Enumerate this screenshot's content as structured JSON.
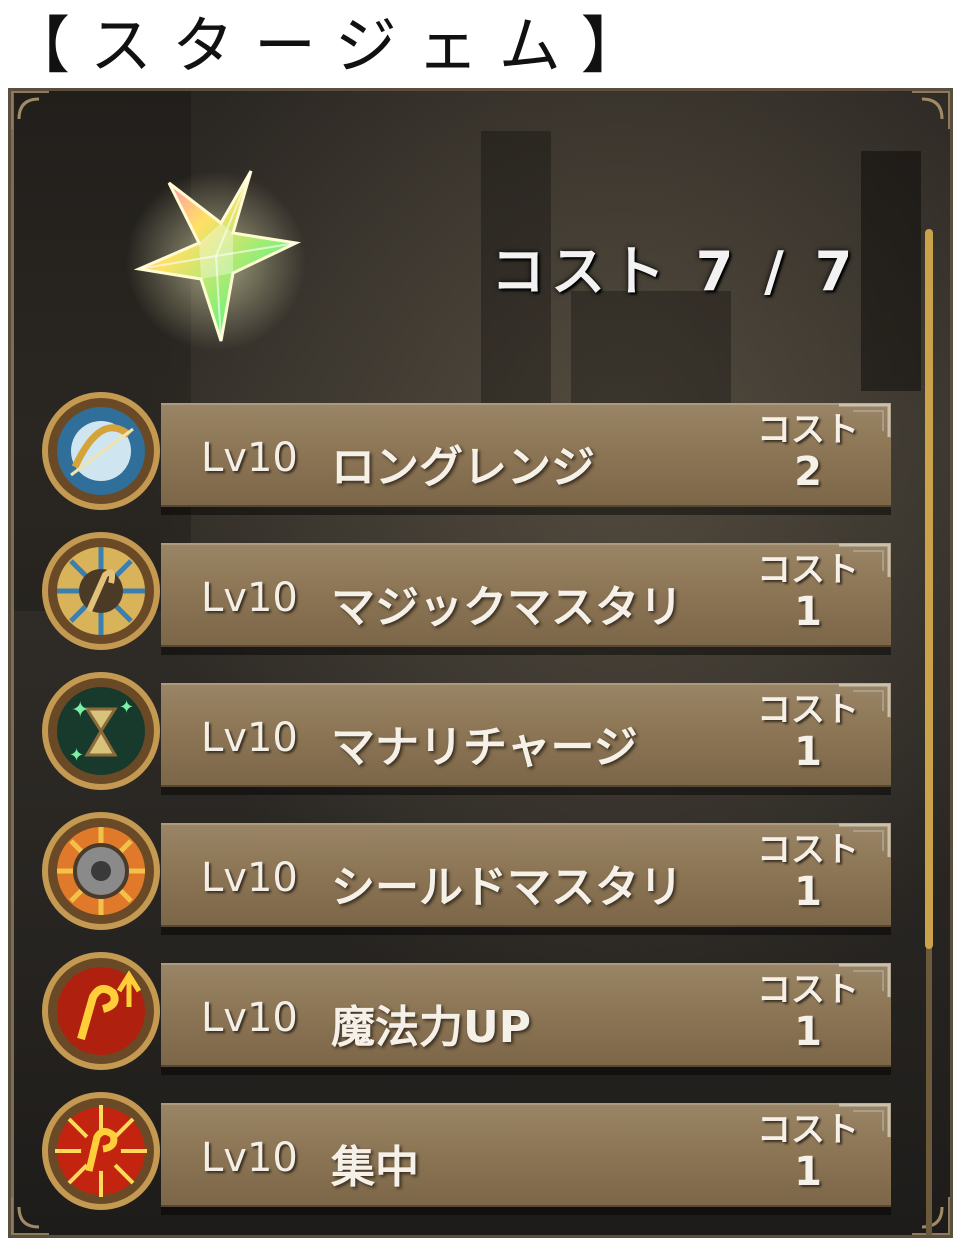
{
  "page_title": "【スタージェム】",
  "cost_summary": "コスト 7 / 7",
  "skills": [
    {
      "level": "Lv10",
      "name": "ロングレンジ",
      "cost_label": "コスト",
      "cost": "2",
      "icon": "bow-icon"
    },
    {
      "level": "Lv10",
      "name": "マジックマスタリ",
      "cost_label": "コスト",
      "cost": "1",
      "icon": "staff-icon"
    },
    {
      "level": "Lv10",
      "name": "マナリチャージ",
      "cost_label": "コスト",
      "cost": "1",
      "icon": "hourglass-icon"
    },
    {
      "level": "Lv10",
      "name": "シールドマスタリ",
      "cost_label": "コスト",
      "cost": "1",
      "icon": "shield-icon"
    },
    {
      "level": "Lv10",
      "name": "魔法力UP",
      "cost_label": "コスト",
      "cost": "1",
      "icon": "magic-up-icon"
    },
    {
      "level": "Lv10",
      "name": "集中",
      "cost_label": "コスト",
      "cost": "1",
      "icon": "focus-icon"
    }
  ],
  "colors": {
    "bar": "#8c7656",
    "medal_ring": "#b08a4a",
    "text": "#f6f1e8"
  }
}
